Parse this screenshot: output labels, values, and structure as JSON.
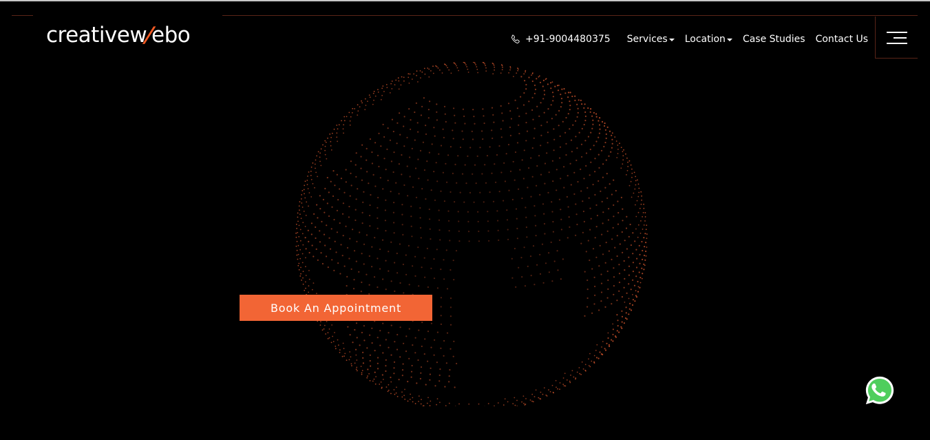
{
  "brand": {
    "logo_part1": "creativew",
    "logo_slash": "/",
    "logo_part2": "ebo",
    "accent_color": "#f15a24"
  },
  "nav": {
    "phone_icon": "phone-icon",
    "phone": "+91-9004480375",
    "items": [
      {
        "label": "Services",
        "has_dropdown": true
      },
      {
        "label": "Location",
        "has_dropdown": true
      },
      {
        "label": "Case Studies",
        "has_dropdown": false
      },
      {
        "label": "Contact Us",
        "has_dropdown": false
      }
    ],
    "menu_icon": "hamburger-menu-icon"
  },
  "hero": {
    "visual": "dotted-globe",
    "cta_label": "Book An Appointment",
    "cta_color": "#f26535"
  },
  "floating": {
    "whatsapp_icon": "whatsapp-icon",
    "whatsapp_color": "#4fce5d"
  }
}
